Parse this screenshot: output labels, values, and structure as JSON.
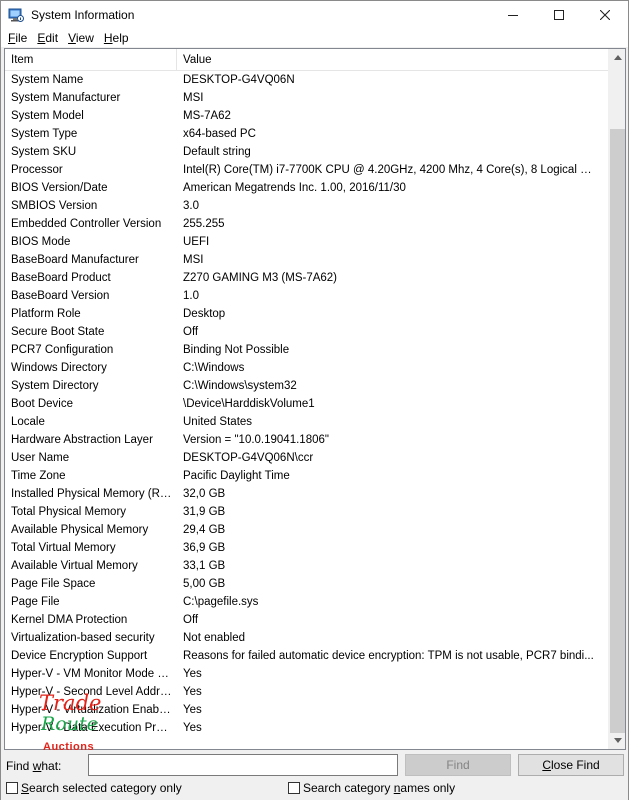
{
  "window": {
    "title": "System Information",
    "icon": "system-information-icon",
    "controls": {
      "minimize": "—",
      "maximize": "☐",
      "close": "✕"
    }
  },
  "menubar": {
    "items": [
      {
        "accel": "F",
        "rest": "ile"
      },
      {
        "accel": "E",
        "rest": "dit"
      },
      {
        "accel": "V",
        "rest": "iew"
      },
      {
        "accel": "H",
        "rest": "elp"
      }
    ]
  },
  "list": {
    "columns": [
      "Item",
      "Value"
    ],
    "rows": [
      {
        "item": "System Name",
        "value": "DESKTOP-G4VQ06N"
      },
      {
        "item": "System Manufacturer",
        "value": "MSI"
      },
      {
        "item": "System Model",
        "value": "MS-7A62"
      },
      {
        "item": "System Type",
        "value": "x64-based PC"
      },
      {
        "item": "System SKU",
        "value": "Default string"
      },
      {
        "item": "Processor",
        "value": "Intel(R) Core(TM) i7-7700K CPU @ 4.20GHz, 4200 Mhz, 4 Core(s), 8 Logical Pr..."
      },
      {
        "item": "BIOS Version/Date",
        "value": "American Megatrends Inc. 1.00, 2016/11/30"
      },
      {
        "item": "SMBIOS Version",
        "value": "3.0"
      },
      {
        "item": "Embedded Controller Version",
        "value": "255.255"
      },
      {
        "item": "BIOS Mode",
        "value": "UEFI"
      },
      {
        "item": "BaseBoard Manufacturer",
        "value": "MSI"
      },
      {
        "item": "BaseBoard Product",
        "value": "Z270 GAMING M3 (MS-7A62)"
      },
      {
        "item": "BaseBoard Version",
        "value": "1.0"
      },
      {
        "item": "Platform Role",
        "value": "Desktop"
      },
      {
        "item": "Secure Boot State",
        "value": "Off"
      },
      {
        "item": "PCR7 Configuration",
        "value": "Binding Not Possible"
      },
      {
        "item": "Windows Directory",
        "value": "C:\\Windows"
      },
      {
        "item": "System Directory",
        "value": "C:\\Windows\\system32"
      },
      {
        "item": "Boot Device",
        "value": "\\Device\\HarddiskVolume1"
      },
      {
        "item": "Locale",
        "value": "United States"
      },
      {
        "item": "Hardware Abstraction Layer",
        "value": "Version = \"10.0.19041.1806\""
      },
      {
        "item": "User Name",
        "value": "DESKTOP-G4VQ06N\\ccr"
      },
      {
        "item": "Time Zone",
        "value": "Pacific Daylight Time"
      },
      {
        "item": "Installed Physical Memory (RAM)",
        "value": "32,0 GB"
      },
      {
        "item": "Total Physical Memory",
        "value": "31,9 GB"
      },
      {
        "item": "Available Physical Memory",
        "value": "29,4 GB"
      },
      {
        "item": "Total Virtual Memory",
        "value": "36,9 GB"
      },
      {
        "item": "Available Virtual Memory",
        "value": "33,1 GB"
      },
      {
        "item": "Page File Space",
        "value": "5,00 GB"
      },
      {
        "item": "Page File",
        "value": "C:\\pagefile.sys"
      },
      {
        "item": "Kernel DMA Protection",
        "value": "Off"
      },
      {
        "item": "Virtualization-based security",
        "value": "Not enabled"
      },
      {
        "item": "Device Encryption Support",
        "value": "Reasons for failed automatic device encryption: TPM is not usable, PCR7 bindi..."
      },
      {
        "item": "Hyper-V - VM Monitor Mode E...",
        "value": "Yes"
      },
      {
        "item": "Hyper-V - Second Level Addres...",
        "value": "Yes"
      },
      {
        "item": "Hyper-V - Virtualization Enable...",
        "value": "Yes"
      },
      {
        "item": "Hyper-V - Data Execution Prote...",
        "value": "Yes"
      }
    ]
  },
  "find": {
    "label_accel": "Find ",
    "label_underlined": "w",
    "label_rest": "hat:",
    "input_value": "",
    "find_button": "Find",
    "close_find_button_accel": "C",
    "close_find_button_rest": "lose Find",
    "search_selected_accel": "S",
    "search_selected_rest": "earch selected category only",
    "search_names_pre": "Search category ",
    "search_names_accel": "n",
    "search_names_rest": "ames only"
  },
  "watermark": {
    "line1": "Trade",
    "line2": "Route",
    "line3": "Auctions"
  }
}
